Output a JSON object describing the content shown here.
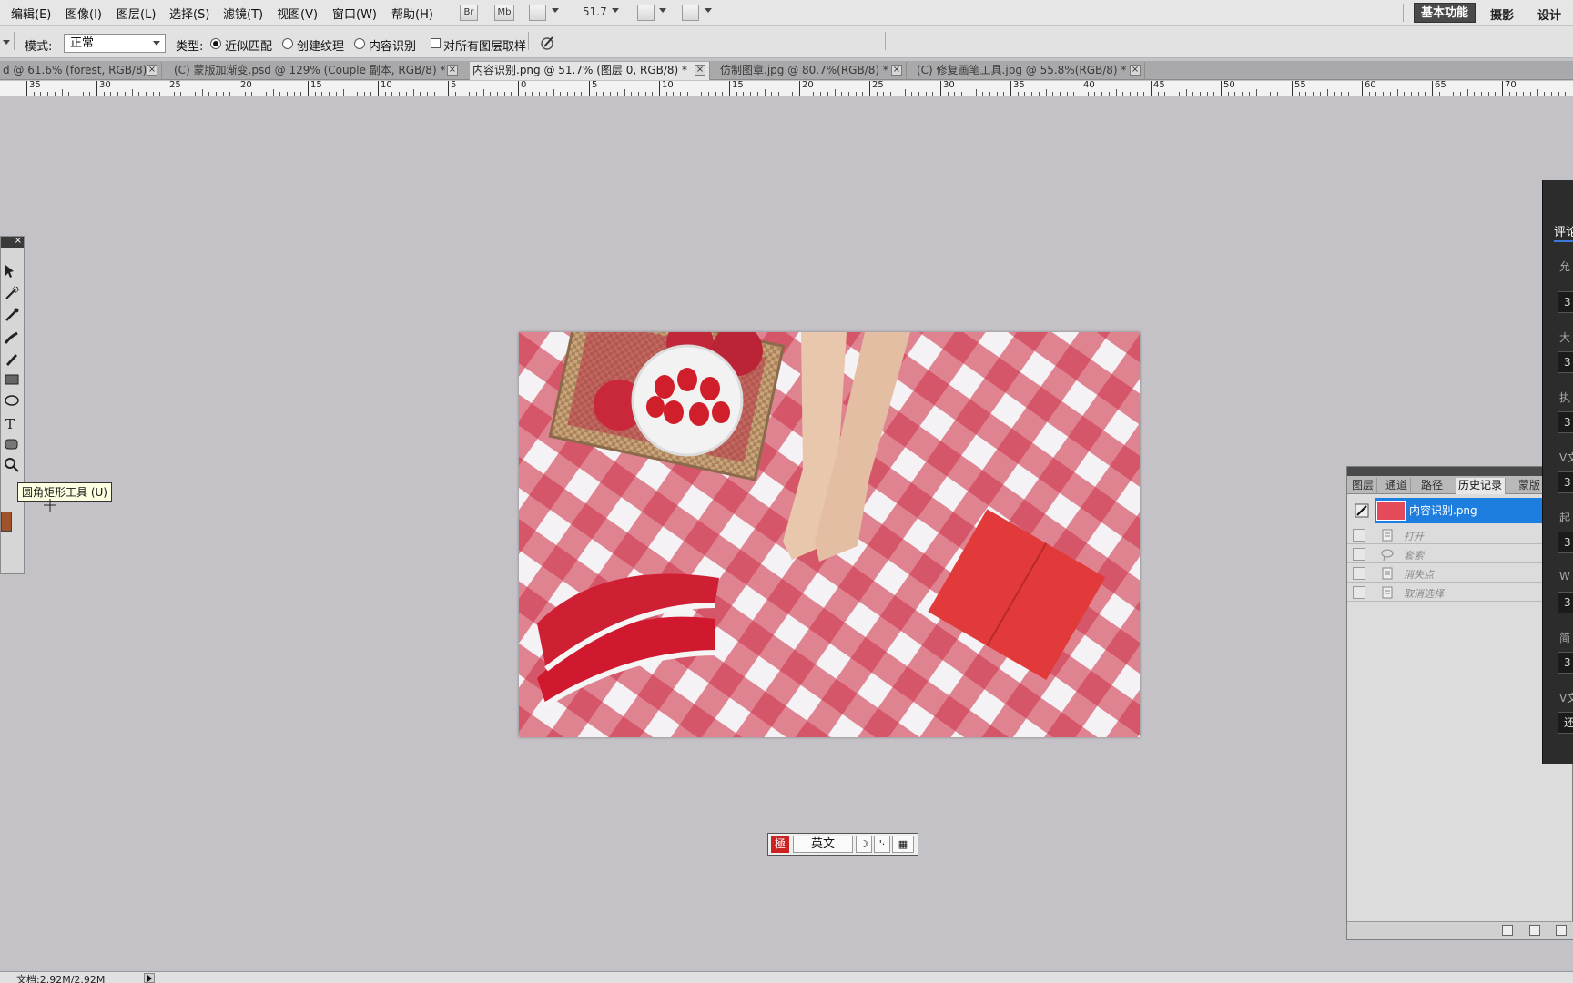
{
  "menubar": {
    "items": [
      "编辑(E)",
      "图像(I)",
      "图层(L)",
      "选择(S)",
      "滤镜(T)",
      "视图(V)",
      "窗口(W)",
      "帮助(H)"
    ],
    "br_label": "Br",
    "mb_label": "Mb",
    "zoom_value": "51.7",
    "workspaces": {
      "active": "基本功能",
      "photography": "摄影",
      "design": "设计"
    }
  },
  "options": {
    "mode_label": "模式:",
    "mode_value": "正常",
    "type_label": "类型:",
    "radio_proximity": "近似匹配",
    "radio_texture": "创建纹理",
    "radio_content": "内容识别",
    "sample_all_layers": "对所有图层取样"
  },
  "tabs": [
    {
      "label": "d @ 61.6% (forest, RGB/8) *"
    },
    {
      "label": "(C) 蒙版加渐变.psd @ 129% (Couple 副本, RGB/8) *"
    },
    {
      "label": "内容识别.png @ 51.7% (图层 0, RGB/8) *"
    },
    {
      "label": "仿制图章.jpg @ 80.7%(RGB/8) *"
    },
    {
      "label": "(C) 修复画笔工具.jpg @ 55.8%(RGB/8) *"
    }
  ],
  "ruler": {
    "labels": [
      "35",
      "30",
      "25",
      "20",
      "15",
      "10",
      "5",
      "0",
      "5",
      "10",
      "15",
      "20",
      "25",
      "30",
      "35",
      "40",
      "45",
      "50",
      "55",
      "60",
      "65",
      "70"
    ]
  },
  "tooltip": {
    "text": "圆角矩形工具 (U)"
  },
  "ime": {
    "seal": "極",
    "lang": "英文",
    "moon": "☽",
    "dots": "'·",
    "keyboard": "▦"
  },
  "history": {
    "tabs": [
      "图层",
      "通道",
      "路径",
      "历史记录",
      "蒙版"
    ],
    "snapshot": "内容识别.png",
    "steps": [
      "打开",
      "套索",
      "消失点",
      "取消选择"
    ]
  },
  "right_panel": {
    "tab": "评论",
    "labels": [
      "允",
      "大",
      "执",
      "V文",
      "起",
      "W",
      "简",
      "V文"
    ],
    "values": [
      "3",
      "3",
      "3",
      "3",
      "3",
      "3",
      "3",
      "还"
    ]
  },
  "status": {
    "text": "文档:2.92M/2.92M"
  },
  "colors": {
    "accent": "#1e7ee0",
    "foreground_swatch": "#a0522d"
  }
}
